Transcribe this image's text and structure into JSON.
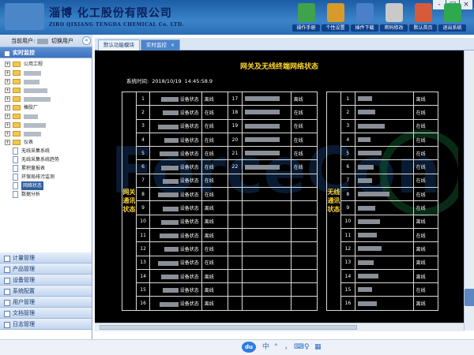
{
  "header": {
    "company_cn": "淄博 化工股份有限公司",
    "company_en": "ZIBO QIXIANG TENGDA CHEMICAL Co. LTD.",
    "window_controls": [
      "-",
      "□",
      "×"
    ],
    "toolbar": [
      {
        "label": "操作手册",
        "icon": "help-icon",
        "color": "#3fa34d"
      },
      {
        "label": "个性设置",
        "icon": "settings-icon",
        "color": "#d89a2b"
      },
      {
        "label": "插件下载",
        "icon": "download-icon",
        "color": "#4a7fc9"
      },
      {
        "label": "密码修改",
        "icon": "key-icon",
        "color": "#c9c9c9"
      },
      {
        "label": "默认首页",
        "icon": "home-icon",
        "color": "#d75a3a"
      },
      {
        "label": "退出系统",
        "icon": "exit-icon",
        "color": "#2fa84f"
      }
    ]
  },
  "userbar": {
    "current_user_label": "当前用户:",
    "switch_user": "切换用户"
  },
  "sidebar": {
    "open_section": "实时监控",
    "tree": [
      {
        "type": "folder",
        "text": "公用工程",
        "pm": "+"
      },
      {
        "type": "folder",
        "text": "",
        "pm": "+"
      },
      {
        "type": "folder",
        "text": "",
        "pm": "+"
      },
      {
        "type": "folder",
        "text": "",
        "pm": "+"
      },
      {
        "type": "folder",
        "text": "",
        "pm": "+"
      },
      {
        "type": "folder",
        "text": "橡胶厂",
        "pm": "+"
      },
      {
        "type": "folder",
        "text": "",
        "pm": "+"
      },
      {
        "type": "folder",
        "text": "",
        "pm": "+"
      },
      {
        "type": "folder",
        "text": "",
        "pm": "+"
      },
      {
        "type": "folder",
        "text": "仪表",
        "pm": "+"
      },
      {
        "type": "page",
        "text": "无线采集系统"
      },
      {
        "type": "page",
        "text": "无线采集系统趋势"
      },
      {
        "type": "page",
        "text": "累积量报表"
      },
      {
        "type": "page",
        "text": "环保局排污监测"
      },
      {
        "type": "page",
        "text": "网络状态",
        "selected": true
      },
      {
        "type": "page",
        "text": "数据分析"
      }
    ],
    "sections": [
      "计量管理",
      "产品管理",
      "设备管理",
      "系统配置",
      "用户管理",
      "文档管理",
      "日志管理"
    ]
  },
  "tabs": [
    {
      "label": "默认功能模块",
      "active": false
    },
    {
      "label": "实时监控",
      "active": true,
      "close": "×"
    }
  ],
  "main": {
    "title": "网关及无线终端网络状态",
    "time_label": "系统时间:",
    "date": "2018/10/19",
    "time": "14:45:58.9",
    "left_side_label": "网关通讯状态",
    "right_side_label": "无线通讯状态",
    "gateway_rows": [
      {
        "no": "1",
        "name": "设备状态",
        "status": "离线",
        "state": "off"
      },
      {
        "no": "2",
        "name": "设备状态",
        "status": "在线",
        "state": "on"
      },
      {
        "no": "3",
        "name": "设备状态",
        "status": "在线",
        "state": "on"
      },
      {
        "no": "4",
        "name": "设备状态",
        "status": "在线",
        "state": "on"
      },
      {
        "no": "5",
        "name": "设备状态",
        "status": "在线",
        "state": "on"
      },
      {
        "no": "6",
        "name": "设备状态",
        "status": "在线",
        "state": "on"
      },
      {
        "no": "7",
        "name": "设备状态",
        "status": "在线",
        "state": "on"
      },
      {
        "no": "8",
        "name": "设备状态",
        "status": "在线",
        "state": "on"
      },
      {
        "no": "9",
        "name": "设备状态",
        "status": "离线",
        "state": "off"
      },
      {
        "no": "10",
        "name": "设备状态",
        "status": "离线",
        "state": "off"
      },
      {
        "no": "11",
        "name": "设备状态",
        "status": "离线",
        "state": "off"
      },
      {
        "no": "12",
        "name": "设备状态",
        "status": "在线",
        "state": "on"
      },
      {
        "no": "13",
        "name": "设备状态",
        "status": "在线",
        "state": "on"
      },
      {
        "no": "14",
        "name": "设备状态",
        "status": "离线",
        "state": "off"
      },
      {
        "no": "15",
        "name": "设备状态",
        "status": "离线",
        "state": "off"
      },
      {
        "no": "16",
        "name": "设备状态",
        "status": "离线",
        "state": "off"
      }
    ],
    "gateway_rows2": [
      {
        "no": "17",
        "name": "",
        "status": "离线",
        "state": "off"
      },
      {
        "no": "18",
        "name": "",
        "status": "在线",
        "state": "on"
      },
      {
        "no": "19",
        "name": "",
        "status": "在线",
        "state": "on"
      },
      {
        "no": "20",
        "name": "",
        "status": "在线",
        "state": "on"
      },
      {
        "no": "21",
        "name": "",
        "status": "在线",
        "state": "on"
      },
      {
        "no": "22",
        "name": "",
        "status": "在线",
        "state": "on"
      }
    ],
    "wireless_rows": [
      {
        "no": "1",
        "status": "离线",
        "state": "off"
      },
      {
        "no": "2",
        "status": "在线",
        "state": "on"
      },
      {
        "no": "3",
        "status": "在线",
        "state": "on"
      },
      {
        "no": "4",
        "status": "在线",
        "state": "on"
      },
      {
        "no": "5",
        "status": "在线",
        "state": "on"
      },
      {
        "no": "6",
        "status": "在线",
        "state": "on"
      },
      {
        "no": "7",
        "status": "在线",
        "state": "on"
      },
      {
        "no": "8",
        "status": "在线",
        "state": "on"
      },
      {
        "no": "9",
        "status": "在线",
        "state": "on"
      },
      {
        "no": "10",
        "status": "离线",
        "state": "off"
      },
      {
        "no": "11",
        "status": "在线",
        "state": "on"
      },
      {
        "no": "12",
        "status": "离线",
        "state": "off"
      },
      {
        "no": "13",
        "status": "离线",
        "state": "off"
      },
      {
        "no": "14",
        "status": "离线",
        "state": "off"
      },
      {
        "no": "15",
        "status": "在线",
        "state": "on"
      },
      {
        "no": "16",
        "status": "离线",
        "state": "off"
      }
    ]
  },
  "footer": {
    "du": "du",
    "ime": [
      "中",
      "°",
      "，",
      "⌨",
      "♀",
      "▦"
    ]
  }
}
